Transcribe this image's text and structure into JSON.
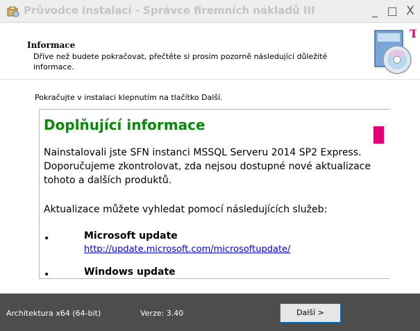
{
  "window": {
    "title": "Průvodce instalací - Správce firemních nákladů III",
    "minimize_label": "_",
    "maximize_label": "□",
    "close_label": "X"
  },
  "header": {
    "title": "Informace",
    "description": "Dříve než budete pokračovat, přečtěte si prosím pozorně následující důležité informace.",
    "logo_icon": "installer-cd-logo-icon"
  },
  "main": {
    "instruction": "Pokračujte v instalaci klepnutím na tlačítko Další.",
    "info": {
      "heading": "Doplňující informace",
      "paragraph1": "Nainstalovali jste SFN instanci MSSQL Serveru 2014 SP2 Express. Doporučujeme zkontrolovat, zda nejsou dostupné nové aktualizace tohoto a dalších produktů.",
      "paragraph2": "Aktualizace můžete vyhledat pomocí následujících služeb:",
      "bullet": "•",
      "items": [
        {
          "title": "Microsoft update",
          "link": "http://update.microsoft.com/microsoftupdate/"
        },
        {
          "title": "Windows update"
        }
      ]
    }
  },
  "footer": {
    "architecture": "Architektura x64 (64-bit)",
    "version": "Verze: 3.40",
    "next_button": "Další >"
  },
  "colors": {
    "heading_green": "#0a8a0a",
    "accent_magenta": "#e0007a",
    "footer_bg": "#4d4d4d",
    "link_blue": "#0000ee"
  }
}
